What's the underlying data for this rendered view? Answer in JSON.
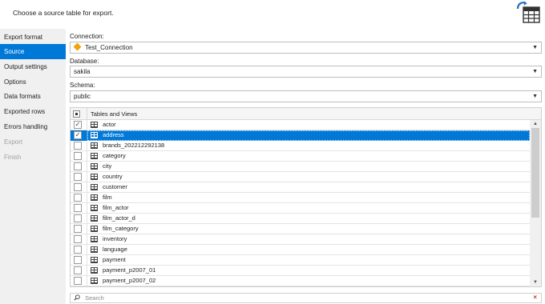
{
  "header": {
    "instruction": "Choose a source table for export.",
    "icon": "table-export-icon"
  },
  "sidebar": {
    "items": [
      {
        "label": "Export format",
        "state": "normal"
      },
      {
        "label": "Source",
        "state": "active"
      },
      {
        "label": "Output settings",
        "state": "normal"
      },
      {
        "label": "Options",
        "state": "normal"
      },
      {
        "label": "Data formats",
        "state": "normal"
      },
      {
        "label": "Exported rows",
        "state": "normal"
      },
      {
        "label": "Errors handling",
        "state": "normal"
      },
      {
        "label": "Export",
        "state": "disabled"
      },
      {
        "label": "Finish",
        "state": "disabled"
      }
    ]
  },
  "connection": {
    "label": "Connection:",
    "value": "Test_Connection"
  },
  "database": {
    "label": "Database:",
    "value": "sakila"
  },
  "schema": {
    "label": "Schema:",
    "value": "public"
  },
  "grid": {
    "header": "Tables and Views",
    "rows": [
      {
        "name": "actor",
        "checked": true,
        "selected": false
      },
      {
        "name": "address",
        "checked": true,
        "selected": true
      },
      {
        "name": "brands_202212292138",
        "checked": false,
        "selected": false
      },
      {
        "name": "category",
        "checked": false,
        "selected": false
      },
      {
        "name": "city",
        "checked": false,
        "selected": false
      },
      {
        "name": "country",
        "checked": false,
        "selected": false
      },
      {
        "name": "customer",
        "checked": false,
        "selected": false
      },
      {
        "name": "film",
        "checked": false,
        "selected": false
      },
      {
        "name": "film_actor",
        "checked": false,
        "selected": false
      },
      {
        "name": "film_actor_d",
        "checked": false,
        "selected": false
      },
      {
        "name": "film_category",
        "checked": false,
        "selected": false
      },
      {
        "name": "inventory",
        "checked": false,
        "selected": false
      },
      {
        "name": "language",
        "checked": false,
        "selected": false
      },
      {
        "name": "payment",
        "checked": false,
        "selected": false
      },
      {
        "name": "payment_p2007_01",
        "checked": false,
        "selected": false
      },
      {
        "name": "payment_p2007_02",
        "checked": false,
        "selected": false
      }
    ]
  },
  "search": {
    "placeholder": "Search"
  },
  "colors": {
    "accent": "#0078d7",
    "sidebar_bg": "#f0f0f0",
    "connection_icon": "#f0a30a",
    "clear": "#d03030"
  }
}
